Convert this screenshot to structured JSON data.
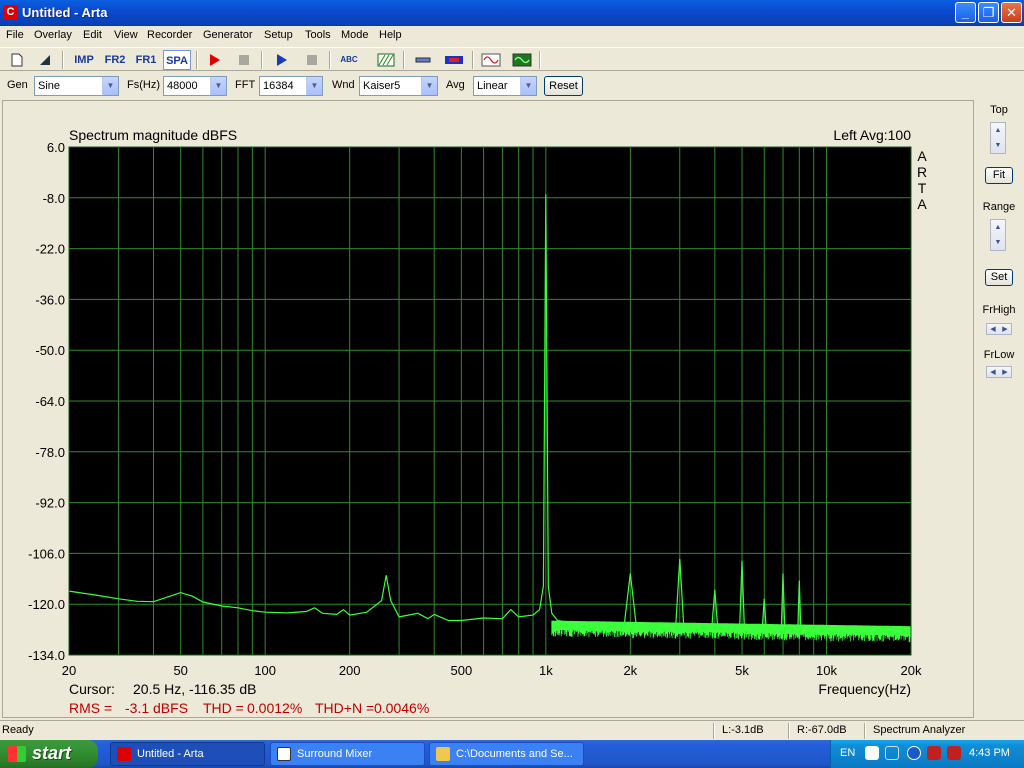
{
  "window": {
    "title": "Untitled - Arta",
    "icon_text": "C",
    "buttons": {
      "minimize": "_",
      "maximize": "❐",
      "close": "✕"
    }
  },
  "menu": [
    "File",
    "Overlay",
    "Edit",
    "View",
    "Recorder",
    "Generator",
    "Setup",
    "Tools",
    "Mode",
    "Help"
  ],
  "toolbar": {
    "imp": "IMP",
    "fr2": "FR2",
    "fr1": "FR1",
    "spa": "SPA",
    "abc": "ABC"
  },
  "settings": {
    "gen_label": "Gen",
    "gen_value": "Sine",
    "fs_label": "Fs(Hz)",
    "fs_value": "48000",
    "fft_label": "FFT",
    "fft_value": "16384",
    "wnd_label": "Wnd",
    "wnd_value": "Kaiser5",
    "avg_label": "Avg",
    "avg_value": "Linear",
    "reset_label": "Reset"
  },
  "right_panel": {
    "top_label": "Top",
    "fit_label": "Fit",
    "range_label": "Range",
    "set_label": "Set",
    "frhigh_label": "FrHigh",
    "frlow_label": "FrLow"
  },
  "status": {
    "ready": "Ready",
    "left_level": "L:-3.1dB",
    "right_level": "R:-67.0dB",
    "mode": "Spectrum Analyzer"
  },
  "taskbar": {
    "start": "start",
    "tasks": [
      "Untitled - Arta",
      "Surround Mixer",
      "C:\\Documents and Se..."
    ],
    "lang": "EN",
    "time": "4:43 PM"
  },
  "colors": {
    "plot_bg": "#000000",
    "grid": "#2f8a2f",
    "trace": "#3cff3c",
    "readout_red": "#c00000"
  },
  "chart_data": {
    "type": "line",
    "title": "Spectrum magnitude dBFS",
    "channel_info": "Left  Avg:100",
    "side_label": "ARTA",
    "xlabel": "Frequency(Hz)",
    "x_scale": "log",
    "xlim": [
      20,
      20000
    ],
    "ylim": [
      -134,
      6
    ],
    "x_tick_labels": [
      "20",
      "50",
      "100",
      "200",
      "500",
      "1k",
      "2k",
      "5k",
      "10k",
      "20k"
    ],
    "x_tick_values": [
      20,
      50,
      100,
      200,
      500,
      1000,
      2000,
      5000,
      10000,
      20000
    ],
    "y_tick_labels": [
      "6.0",
      "-8.0",
      "-22.0",
      "-36.0",
      "-50.0",
      "-64.0",
      "-78.0",
      "-92.0",
      "-106.0",
      "-120.0",
      "-134.0"
    ],
    "y_tick_values": [
      6,
      -8,
      -22,
      -36,
      -50,
      -64,
      -78,
      -92,
      -106,
      -120,
      -134
    ],
    "grid": true,
    "cursor_label": "Cursor:",
    "cursor_value": "20.5 Hz, -116.35 dB",
    "rms_label": "RMS =",
    "rms_value": "-3.1 dBFS",
    "thd_label": "THD =",
    "thd_value": "0.0012%",
    "thdn_label": "THD+N =",
    "thdn_value": "0.0046%",
    "series": [
      {
        "x": [
          20,
          25,
          30,
          35,
          40,
          45,
          50,
          55,
          60,
          70,
          80,
          90,
          100,
          120,
          140,
          150,
          160,
          180,
          190,
          200,
          230,
          260,
          270,
          280,
          300,
          350,
          380,
          400,
          450,
          500,
          600,
          700,
          750,
          800,
          900,
          950,
          980,
          1000,
          1020,
          1050,
          1100,
          1200,
          1500,
          1900,
          2000,
          2100,
          2500,
          2900,
          3000,
          3100,
          3500,
          3900,
          4000,
          4100,
          4900,
          5000,
          5100,
          5900,
          6000,
          6100,
          6900,
          7000,
          7100,
          7900,
          8000,
          8100,
          9000,
          10000,
          11000,
          12000,
          13000,
          14000,
          15000,
          16000,
          17000,
          18000,
          19000,
          20000
        ],
        "y": [
          -116.4,
          -117.5,
          -118.5,
          -119.2,
          -119.3,
          -118.0,
          -116.8,
          -117.8,
          -119.4,
          -120.5,
          -121.0,
          -121.8,
          -122.2,
          -122.4,
          -122.0,
          -121.0,
          -122.5,
          -122.8,
          -121.5,
          -123.0,
          -122.2,
          -119.0,
          -112.0,
          -119.0,
          -123.5,
          -122.5,
          -124.0,
          -122.8,
          -124.5,
          -124.5,
          -123.8,
          -124.0,
          -121.5,
          -123.5,
          -123.0,
          -121.5,
          -115.0,
          -7.0,
          -115.0,
          -122.5,
          -124.5,
          -125.0,
          -125.8,
          -126.0,
          -111.5,
          -126.0,
          -126.3,
          -126.5,
          -107.5,
          -126.5,
          -126.5,
          -126.8,
          -116.0,
          -126.8,
          -126.8,
          -108.0,
          -126.8,
          -127.0,
          -118.5,
          -127.0,
          -127.0,
          -111.5,
          -127.2,
          -127.2,
          -113.5,
          -127.2,
          -127.3,
          -126.8,
          -127.0,
          -126.5,
          -126.8,
          -126.5,
          -126.8,
          -126.2,
          -126.8,
          -126.5,
          -126.8,
          -126.2
        ]
      }
    ]
  }
}
